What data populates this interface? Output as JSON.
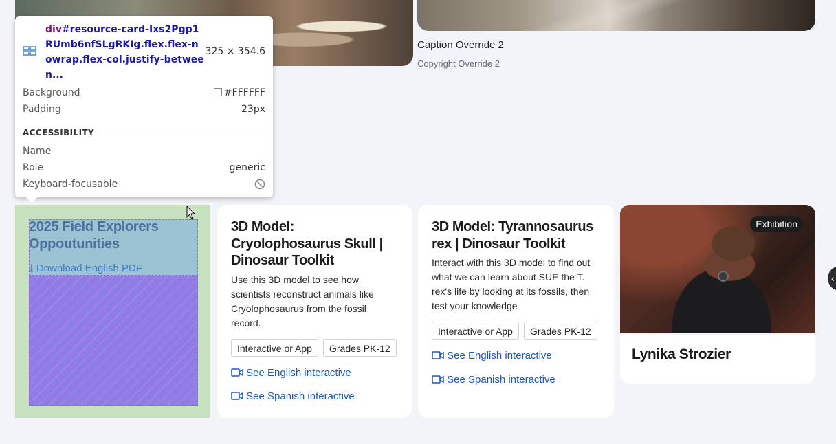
{
  "top": {
    "caption": "Caption Override 2",
    "copyright": "Copyright Override 2"
  },
  "tooltip": {
    "tag": "div",
    "selector": "#resource-card-Ixs2Pgp1RUmb6nfSLgRKIg.flex.flex-nowrap.flex-col.justify-between...",
    "selector_display": "#resource-card-Ixs2Pgp1RUmb6nfSLgRKIg.flex.flex-nowrap.flex-col.justify-betwee n...",
    "dimensions": "325 × 354.6",
    "background_label": "Background",
    "background_value": "#FFFFFF",
    "padding_label": "Padding",
    "padding_value": "23px",
    "section": "ACCESSIBILITY",
    "name_label": "Name",
    "role_label": "Role",
    "role_value": "generic",
    "focusable_label": "Keyboard-focusable"
  },
  "cards": [
    {
      "title": "2025 Field Explorers Oppoutunities",
      "link": "Download English PDF"
    },
    {
      "title": "3D Model: Cryolophosaurus Skull | Dinosaur Toolkit",
      "description": "Use this 3D model to see how scientists reconstruct animals like Cryolophosaurus from the fossil record.",
      "tags": [
        "Interactive or App",
        "Grades PK-12"
      ],
      "links": [
        "See English interactive",
        "See Spanish interactive"
      ]
    },
    {
      "title": "3D Model: Tyrannosaurus rex | Dinosaur Toolkit",
      "description": "Interact with this 3D model to find out what we can learn about SUE the T. rex's life by looking at its fossils, then test your knowledge",
      "tags": [
        "Interactive or App",
        "Grades PK-12"
      ],
      "links": [
        "See English interactive",
        "See Spanish interactive"
      ]
    },
    {
      "badge": "Exhibition",
      "name": "Lynika Strozier"
    }
  ],
  "icons": {
    "tooltip_icon": "grid-layout-icon",
    "download": "download-icon",
    "video": "video-camera-icon",
    "no_entry": "not-focusable-icon",
    "cursor": "mouse-pointer-icon"
  },
  "colors": {
    "page_bg": "#f3f4f9",
    "link": "#1c58c2",
    "highlight_content": "#78aae6",
    "highlight_padding": "#8d7ee6",
    "highlight_margin": "#c8e2bf"
  }
}
